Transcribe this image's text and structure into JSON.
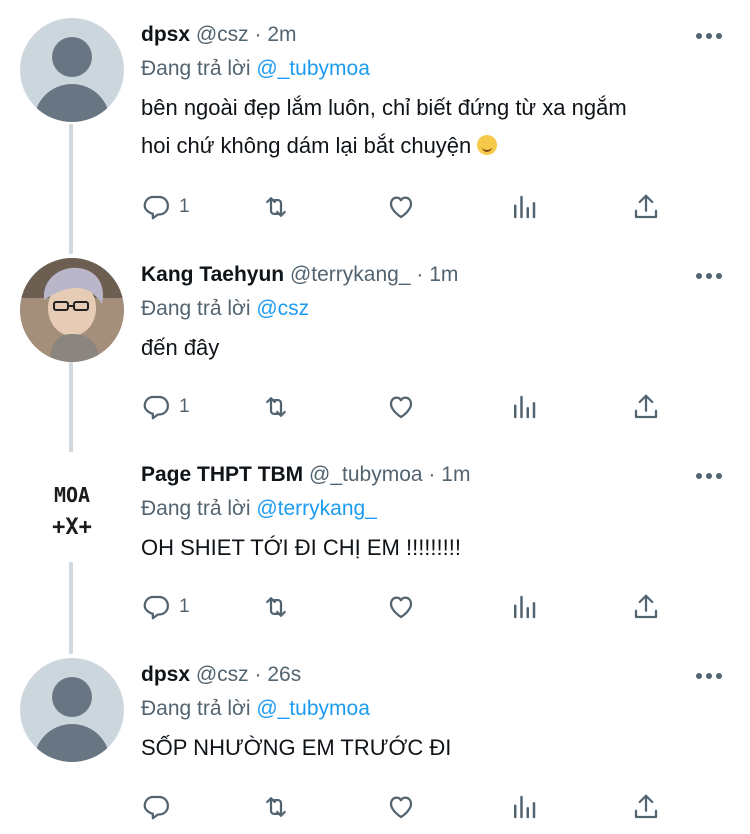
{
  "tweets": [
    {
      "name": "dpsx",
      "handle": "@csz",
      "dot": "·",
      "time": "2m",
      "reply_prefix": "Đang trả lời",
      "reply_to": "@_tubymoa",
      "text_line1": "bên ngoài đẹp lắm luôn, chỉ biết đứng từ xa ngắm",
      "text_line2": "hoi chứ không dám lại bắt chuyện",
      "reply_count": "1"
    },
    {
      "name": "Kang Taehyun",
      "handle": "@terrykang_",
      "dot": "·",
      "time": "1m",
      "reply_prefix": "Đang trả lời",
      "reply_to": "@csz",
      "text": "đến đây",
      "reply_count": "1"
    },
    {
      "name": "Page THPT TBM",
      "handle": "@_tubymoa",
      "dot": "·",
      "time": "1m",
      "reply_prefix": "Đang trả lời",
      "reply_to": "@terrykang_",
      "text": "OH SHIET TỚI ĐI CHỊ EM !!!!!!!!!",
      "reply_count": "1",
      "avatar_text_line1": "MOA",
      "avatar_text_line2": "+X+"
    },
    {
      "name": "dpsx",
      "handle": "@csz",
      "dot": "·",
      "time": "26s",
      "reply_prefix": "Đang trả lời",
      "reply_to": "@_tubymoa",
      "text": "SỐP NHƯỜNG EM TRƯỚC ĐI",
      "reply_count": ""
    }
  ],
  "icons": {
    "reply": "reply-icon",
    "retweet": "retweet-icon",
    "like": "like-icon",
    "analytics": "analytics-icon",
    "share": "share-icon",
    "more": "more-icon",
    "emoji": "sweat-smile-emoji"
  },
  "colors": {
    "link": "#1d9bf0",
    "muted": "#536471",
    "thread_line": "#cfd9de"
  }
}
